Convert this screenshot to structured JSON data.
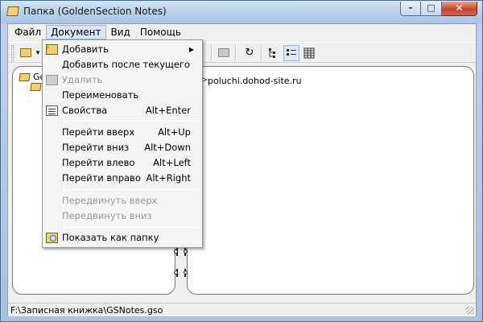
{
  "window": {
    "title": "Папка (GoldenSection Notes)",
    "accent": "#a9c5e3",
    "close_color": "#c7452c",
    "buttons": {
      "minimize": "–",
      "maximize": "□",
      "close": "✕"
    }
  },
  "menubar": {
    "items": [
      {
        "label": "Файл"
      },
      {
        "label": "Документ"
      },
      {
        "label": "Вид"
      },
      {
        "label": "Помощь"
      }
    ],
    "active_index": 1
  },
  "toolbar": {
    "icons": [
      "open-folder-icon",
      "dropdown-arrow-icon",
      "folder-disabled-icon",
      "refresh-icon",
      "tree-view-icon",
      "list-view-icon",
      "grid-view-icon"
    ],
    "dropdown_arrow": "▾",
    "refresh": "↻"
  },
  "tree": {
    "root_label": "Go"
  },
  "content": {
    "url": "poluchi.dohod-site.ru",
    "url_prefix": ">"
  },
  "dropdown": {
    "submenu_arrow": "▶",
    "items": [
      {
        "label": "Добавить",
        "shortcut": "",
        "disabled": false,
        "submenu": true,
        "icon": "add-icon"
      },
      {
        "label": "Добавить после текущего",
        "shortcut": "",
        "disabled": false
      },
      {
        "label": "Удалить",
        "shortcut": "",
        "disabled": true,
        "icon": "delete-icon"
      },
      {
        "label": "Переименовать",
        "shortcut": "",
        "disabled": false
      },
      {
        "label": "Свойства",
        "shortcut": "Alt+Enter",
        "disabled": false,
        "icon": "properties-icon"
      },
      {
        "label": "Перейти вверх",
        "shortcut": "Alt+Up",
        "disabled": false
      },
      {
        "label": "Перейти вниз",
        "shortcut": "Alt+Down",
        "disabled": false
      },
      {
        "label": "Перейти влево",
        "shortcut": "Alt+Left",
        "disabled": false
      },
      {
        "label": "Перейти вправо",
        "shortcut": "Alt+Right",
        "disabled": false
      },
      {
        "label": "Передвинуть вверх",
        "shortcut": "",
        "disabled": true
      },
      {
        "label": "Передвинуть вниз",
        "shortcut": "",
        "disabled": true
      },
      {
        "label": "Показать как папку",
        "shortcut": "",
        "disabled": false,
        "icon": "show-as-folder-icon"
      }
    ]
  },
  "statusbar": {
    "path": "F:\\Записная книжка\\GSNotes.gso"
  }
}
